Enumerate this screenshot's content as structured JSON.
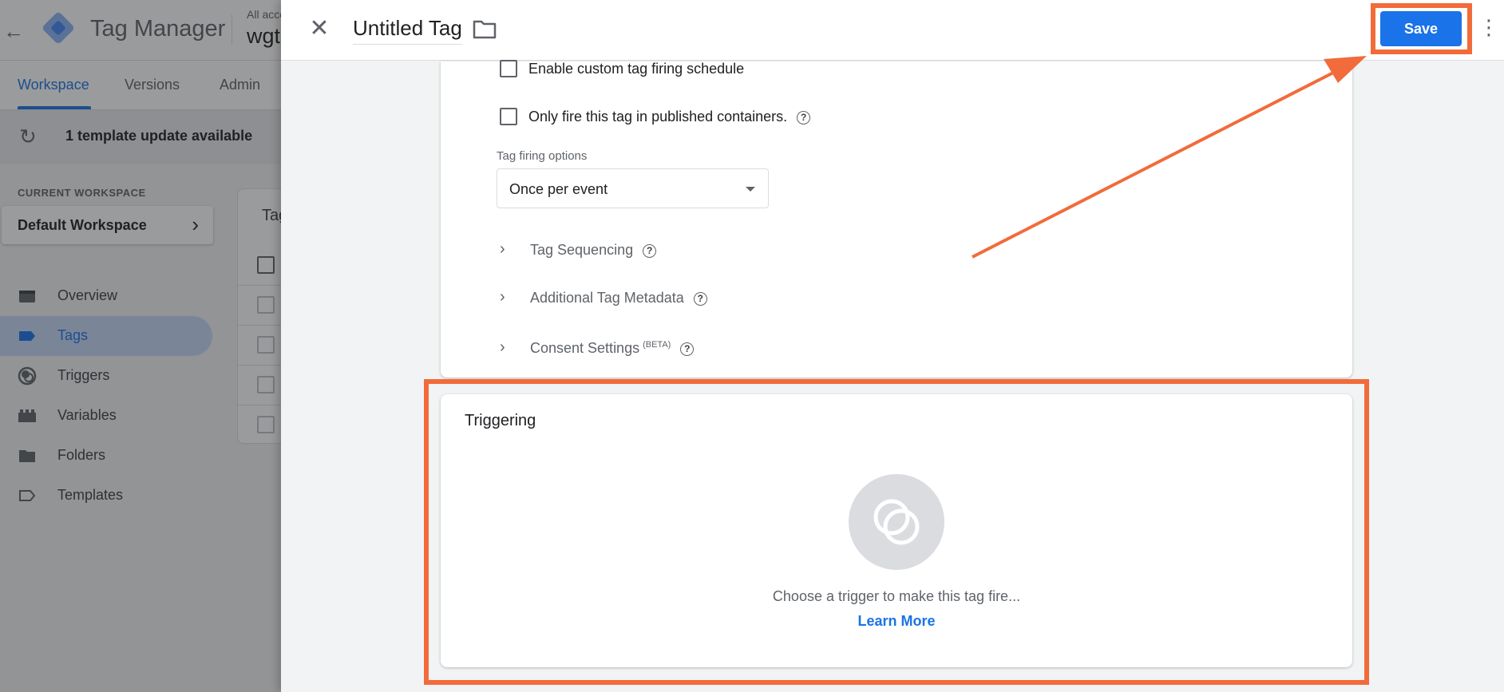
{
  "background": {
    "app_title": "Tag Manager",
    "account_label": "All acco",
    "account_name": "wgt",
    "nav_tabs": [
      {
        "label": "Workspace",
        "active": true
      },
      {
        "label": "Versions",
        "active": false
      },
      {
        "label": "Admin",
        "active": false
      }
    ],
    "update_banner": "1 template update available",
    "current_workspace_label": "CURRENT WORKSPACE",
    "workspace_name": "Default Workspace",
    "sidebar": [
      {
        "label": "Overview",
        "icon": "overview-icon",
        "active": false
      },
      {
        "label": "Tags",
        "icon": "tag-icon",
        "active": true
      },
      {
        "label": "Triggers",
        "icon": "triggers-icon",
        "active": false
      },
      {
        "label": "Variables",
        "icon": "variables-icon",
        "active": false
      },
      {
        "label": "Folders",
        "icon": "folder-icon",
        "active": false
      },
      {
        "label": "Templates",
        "icon": "templates-icon",
        "active": false
      }
    ],
    "tags_card_title": "Tag"
  },
  "panel": {
    "tag_name": "Untitled Tag",
    "save_label": "Save",
    "advanced": {
      "custom_schedule_label": "Enable custom tag firing schedule",
      "custom_schedule_checked": false,
      "published_only_label": "Only fire this tag in published containers.",
      "published_only_checked": false,
      "firing_options_label": "Tag firing options",
      "firing_option_value": "Once per event",
      "expanders": [
        {
          "label": "Tag Sequencing",
          "badge": ""
        },
        {
          "label": "Additional Tag Metadata",
          "badge": ""
        },
        {
          "label": "Consent Settings",
          "badge": "(BETA)"
        }
      ]
    },
    "triggering": {
      "title": "Triggering",
      "empty_text": "Choose a trigger to make this tag fire...",
      "learn_more": "Learn More"
    }
  },
  "colors": {
    "accent": "#1a73e8",
    "annotation": "#f26b3a",
    "active_nav_bg": "#c6d8f7"
  }
}
